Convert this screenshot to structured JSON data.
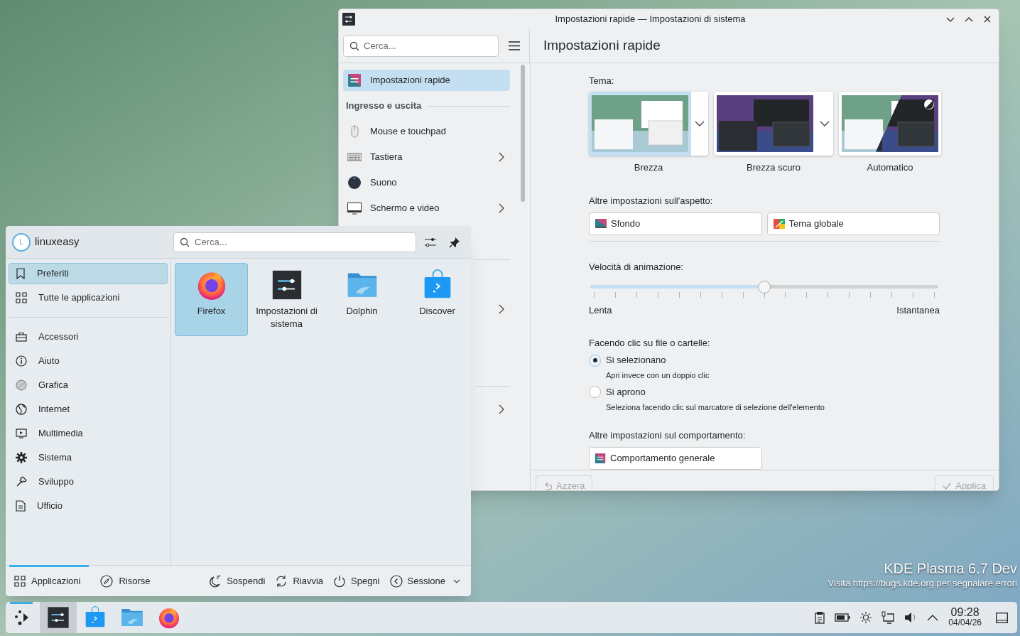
{
  "settings_window": {
    "title": "Impostazioni rapide — Impostazioni di sistema",
    "search": {
      "placeholder": "Cerca..."
    },
    "page_title": "Impostazioni rapide",
    "sidebar": [
      {
        "kind": "item",
        "label": "Impostazioni rapide",
        "selected": true,
        "has_children": false
      },
      {
        "kind": "header",
        "label": "Ingresso e uscita"
      },
      {
        "kind": "item",
        "label": "Mouse e touchpad",
        "selected": false,
        "has_children": false
      },
      {
        "kind": "item",
        "label": "Tastiera",
        "selected": false,
        "has_children": true
      },
      {
        "kind": "item",
        "label": "Suono",
        "selected": false,
        "has_children": false
      },
      {
        "kind": "item",
        "label": "Schermo e video",
        "selected": false,
        "has_children": true
      }
    ],
    "theme": {
      "label": "Tema:",
      "options": [
        {
          "name": "Brezza",
          "kind": "light",
          "selected": true,
          "has_menu": true
        },
        {
          "name": "Brezza scuro",
          "kind": "dark",
          "selected": false,
          "has_menu": true
        },
        {
          "name": "Automatico",
          "kind": "auto",
          "selected": false,
          "has_menu": false
        }
      ]
    },
    "appearance": {
      "label": "Altre impostazioni sull'aspetto:",
      "buttons": [
        "Sfondo",
        "Tema globale"
      ]
    },
    "animation": {
      "label": "Velocità di animazione:",
      "level": 0.5,
      "min_label": "Lenta",
      "max_label": "Istantanea"
    },
    "click": {
      "label": "Facendo clic su file o cartelle:",
      "options": [
        {
          "label": "Si selezionano",
          "hint": "Apri invece con un doppio clic",
          "selected": true
        },
        {
          "label": "Si aprono",
          "hint": "Seleziona facendo clic sul marcatore di selezione dell'elemento",
          "selected": false
        }
      ]
    },
    "behavior": {
      "label": "Altre impostazioni sul comportamento:",
      "buttons": [
        "Comportamento generale"
      ]
    },
    "footer": [
      {
        "label": "Azzera",
        "disabled": true
      },
      {
        "label": "Applica",
        "disabled": true
      }
    ]
  },
  "launcher": {
    "user": {
      "initial": "L",
      "name": "linuxeasy"
    },
    "search": {
      "placeholder": "Cerca..."
    },
    "views": [
      {
        "label": "Preferiti",
        "selected": true
      },
      {
        "label": "Tutte le applicazioni",
        "selected": false
      }
    ],
    "categories": [
      {
        "label": "Accessori",
        "selected": false
      },
      {
        "label": "Aiuto",
        "selected": false
      },
      {
        "label": "Grafica",
        "selected": false
      },
      {
        "label": "Internet",
        "selected": false
      },
      {
        "label": "Multimedia",
        "selected": false
      },
      {
        "label": "Sistema",
        "selected": false
      },
      {
        "label": "Sviluppo",
        "selected": false
      },
      {
        "label": "Ufficio",
        "selected": false
      }
    ],
    "apps": [
      {
        "name": "Firefox",
        "selected": true
      },
      {
        "name": "Impostazioni di sistema",
        "selected": false
      },
      {
        "name": "Dolphin",
        "selected": false
      },
      {
        "name": "Discover",
        "selected": false
      }
    ],
    "tabs": [
      {
        "label": "Applicazioni",
        "selected": true
      },
      {
        "label": "Risorse",
        "selected": false
      }
    ],
    "actions": [
      "Sospendi",
      "Riavvia",
      "Spegni",
      "Sessione"
    ]
  },
  "desktop_notice": {
    "title": "KDE Plasma 6.7 Dev",
    "text": "Visita https://bugs.kde.org per segnalare errori"
  },
  "taskbar": {
    "launcher_open": true,
    "tasks": [
      {
        "kind": "settings",
        "active": true
      },
      {
        "kind": "store",
        "active": false
      },
      {
        "kind": "files",
        "active": false
      },
      {
        "kind": "browser",
        "active": false
      }
    ],
    "clock": {
      "time": "09:28",
      "date": "04/04/26"
    }
  }
}
